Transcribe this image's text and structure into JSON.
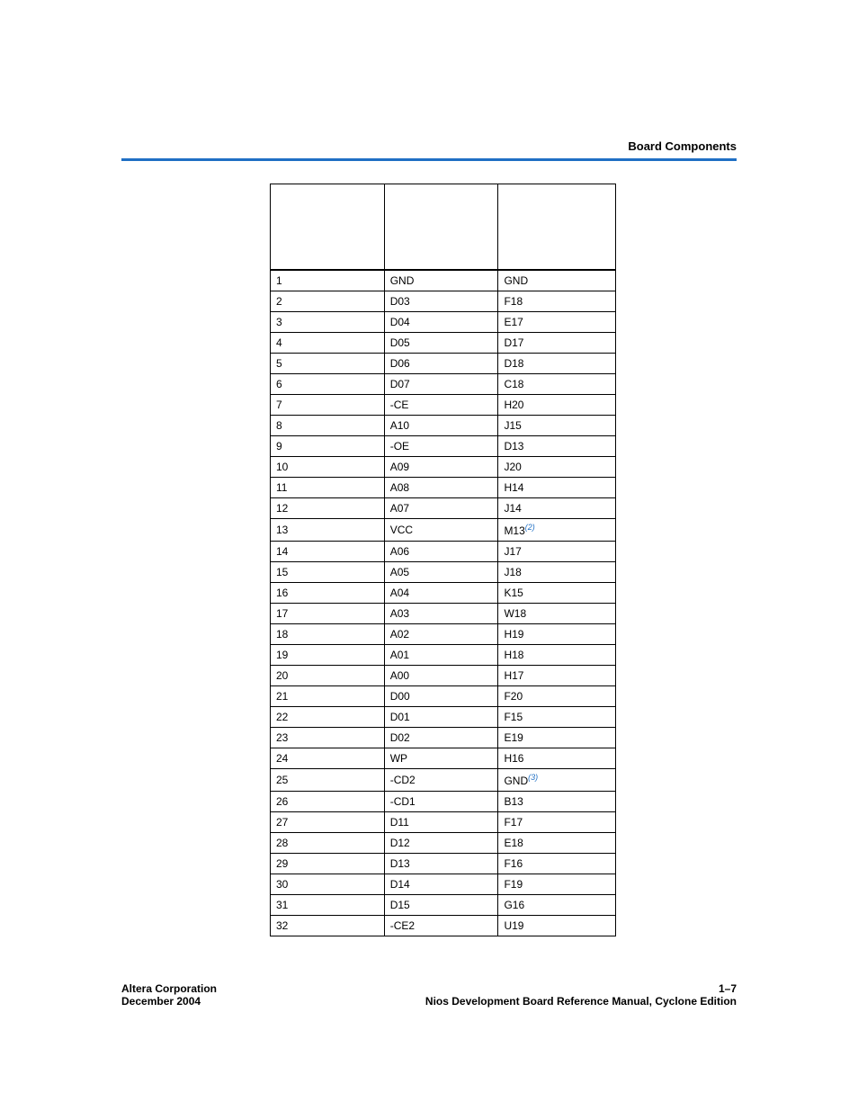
{
  "header": {
    "title": "Board Components"
  },
  "table": {
    "rows": [
      {
        "c1": "1",
        "c2": "GND",
        "c3": "GND",
        "note": ""
      },
      {
        "c1": "2",
        "c2": "D03",
        "c3": "F18",
        "note": ""
      },
      {
        "c1": "3",
        "c2": "D04",
        "c3": "E17",
        "note": ""
      },
      {
        "c1": "4",
        "c2": "D05",
        "c3": "D17",
        "note": ""
      },
      {
        "c1": "5",
        "c2": "D06",
        "c3": "D18",
        "note": ""
      },
      {
        "c1": "6",
        "c2": "D07",
        "c3": "C18",
        "note": ""
      },
      {
        "c1": "7",
        "c2": "-CE",
        "c3": "H20",
        "note": ""
      },
      {
        "c1": "8",
        "c2": "A10",
        "c3": "J15",
        "note": ""
      },
      {
        "c1": "9",
        "c2": "-OE",
        "c3": "D13",
        "note": ""
      },
      {
        "c1": "10",
        "c2": "A09",
        "c3": "J20",
        "note": ""
      },
      {
        "c1": "11",
        "c2": "A08",
        "c3": "H14",
        "note": ""
      },
      {
        "c1": "12",
        "c2": "A07",
        "c3": "J14",
        "note": ""
      },
      {
        "c1": "13",
        "c2": "VCC",
        "c3": "M13",
        "note": "(2)"
      },
      {
        "c1": "14",
        "c2": "A06",
        "c3": "J17",
        "note": ""
      },
      {
        "c1": "15",
        "c2": "A05",
        "c3": "J18",
        "note": ""
      },
      {
        "c1": "16",
        "c2": "A04",
        "c3": "K15",
        "note": ""
      },
      {
        "c1": "17",
        "c2": "A03",
        "c3": "W18",
        "note": ""
      },
      {
        "c1": "18",
        "c2": "A02",
        "c3": "H19",
        "note": ""
      },
      {
        "c1": "19",
        "c2": "A01",
        "c3": "H18",
        "note": ""
      },
      {
        "c1": "20",
        "c2": "A00",
        "c3": "H17",
        "note": ""
      },
      {
        "c1": "21",
        "c2": "D00",
        "c3": "F20",
        "note": ""
      },
      {
        "c1": "22",
        "c2": "D01",
        "c3": "F15",
        "note": ""
      },
      {
        "c1": "23",
        "c2": "D02",
        "c3": "E19",
        "note": ""
      },
      {
        "c1": "24",
        "c2": "WP",
        "c3": "H16",
        "note": ""
      },
      {
        "c1": "25",
        "c2": "-CD2",
        "c3": "GND",
        "note": "(3)"
      },
      {
        "c1": "26",
        "c2": "-CD1",
        "c3": "B13",
        "note": ""
      },
      {
        "c1": "27",
        "c2": "D11",
        "c3": "F17",
        "note": ""
      },
      {
        "c1": "28",
        "c2": "D12",
        "c3": "E18",
        "note": ""
      },
      {
        "c1": "29",
        "c2": "D13",
        "c3": "F16",
        "note": ""
      },
      {
        "c1": "30",
        "c2": "D14",
        "c3": "F19",
        "note": ""
      },
      {
        "c1": "31",
        "c2": "D15",
        "c3": "G16",
        "note": ""
      },
      {
        "c1": "32",
        "c2": "-CE2",
        "c3": "U19",
        "note": ""
      }
    ]
  },
  "footer": {
    "left_line1": "Altera Corporation",
    "left_line2": "December 2004",
    "right_line1": "1–7",
    "right_line2": "Nios Development Board Reference Manual, Cyclone Edition"
  }
}
